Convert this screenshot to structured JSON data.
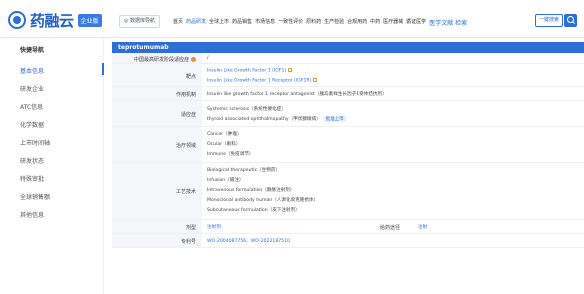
{
  "header": {
    "logo_text": "药融云",
    "logo_badge": "企业版",
    "data_nav_label": "◎ 数据库导航",
    "nav_items": [
      "首页",
      "药品研发",
      "全球上市",
      "药品销售",
      "市场信息",
      "一致性评价",
      "原料药",
      "生产检验",
      "合规用药",
      "中药",
      "医疗器械",
      "循证医学"
    ],
    "nav_accent": "医学文献 检索",
    "search_label": "一键搜索"
  },
  "sidebar": {
    "title": "快捷导航",
    "items": [
      "基本信息",
      "研发企业",
      "ATC信息",
      "化学数据",
      "上市时间轴",
      "研发状态",
      "特殊审批",
      "全球销售额",
      "其他信息"
    ]
  },
  "drug": {
    "name": "teprotumumab"
  },
  "details": {
    "highest_stage_label": "中国最高研发阶段适应症",
    "highest_stage_value": "/",
    "target_label": "靶点",
    "targets": [
      "Insulin Like Growth Factor 1 (IGF1)",
      "Insulin Like Growth Factor 1 Receptor (IGF1R)"
    ],
    "mechanism_label": "作用机制",
    "mechanism_value": "Insulin like growth factor 1 receptor antagonist（胰岛素样生长因子1受体拮抗剂）",
    "indication_label": "适应症",
    "indications": [
      "Systemic sclerosis（系统性硬化症）",
      "thyroid associated ophthalmopathy（甲状腺眼病）"
    ],
    "indication_tag": "批准上市",
    "therapy_label": "治疗领域",
    "therapy_areas": [
      "Cancer（肿瘤）",
      "Ocular（眼科）",
      "Immune（免疫调节）"
    ],
    "process_label": "工艺技术",
    "processes": [
      "Biological therapeutic（生物药）",
      "Infusion（输注）",
      "Intravenous formulation（静脉注射剂）",
      "Monoclonal antibody human（人源化单克隆抗体）",
      "Subcutaneous formulation（皮下注射剂）"
    ],
    "dosage_label": "剂型",
    "dosage_value": "注射剂",
    "adr_label": "给药途径",
    "adr_value": "注射",
    "patent_label": "专利号",
    "patent_value": "WO-2004087756、WO-2022187510"
  }
}
